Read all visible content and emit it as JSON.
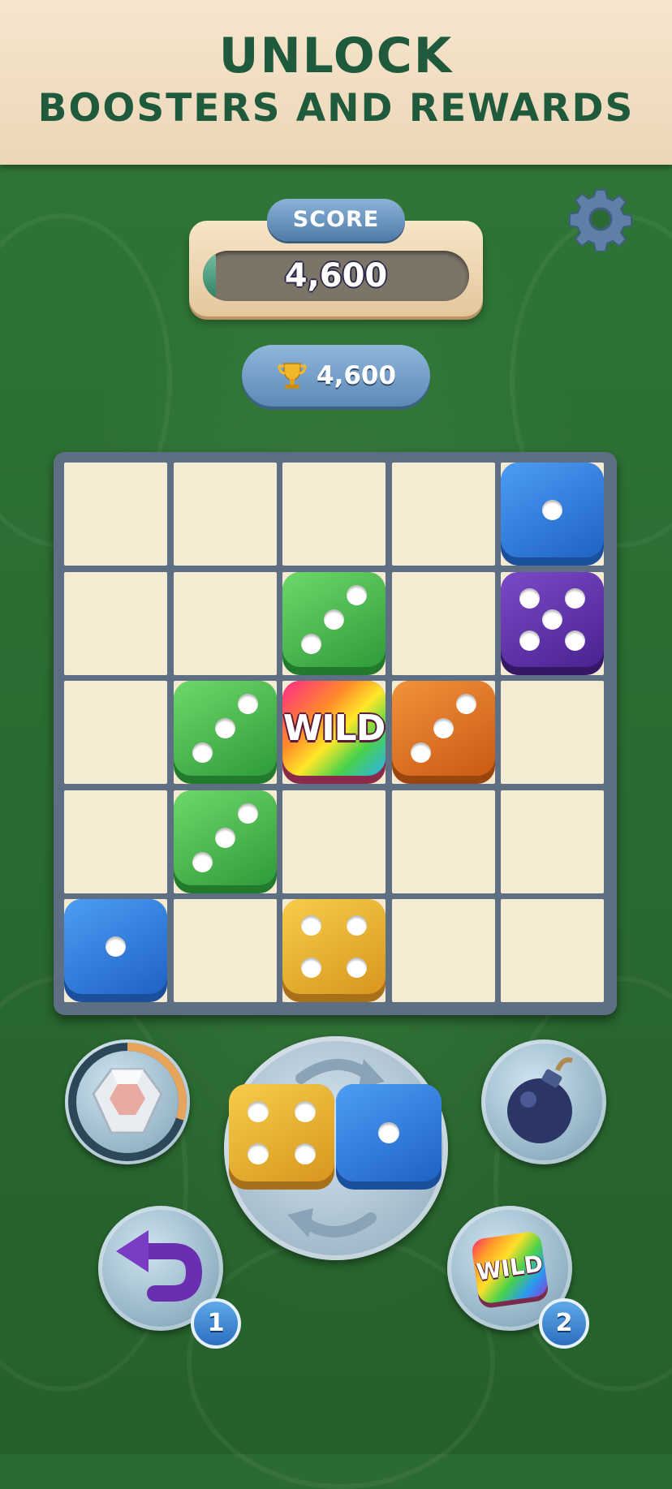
{
  "banner": {
    "line1": "UNLOCK",
    "line2": "BOOSTERS AND REWARDS"
  },
  "header": {
    "score_label": "SCORE",
    "score_value": "4,600",
    "score_progress": 0.05,
    "best_value": "4,600",
    "settings_icon": "gear-icon",
    "best_icon": "trophy-icon"
  },
  "board": {
    "rows": 5,
    "cols": 5,
    "dice": [
      {
        "row": 0,
        "col": 4,
        "value": 1,
        "color": "blue"
      },
      {
        "row": 1,
        "col": 2,
        "value": 3,
        "color": "green"
      },
      {
        "row": 1,
        "col": 4,
        "value": 5,
        "color": "purple"
      },
      {
        "row": 2,
        "col": 1,
        "value": 3,
        "color": "green"
      },
      {
        "row": 2,
        "col": 2,
        "value": "WILD",
        "color": "rainbow"
      },
      {
        "row": 2,
        "col": 3,
        "value": 3,
        "color": "orange"
      },
      {
        "row": 3,
        "col": 1,
        "value": 3,
        "color": "green"
      },
      {
        "row": 4,
        "col": 0,
        "value": 1,
        "color": "blue"
      },
      {
        "row": 4,
        "col": 2,
        "value": 4,
        "color": "yellow"
      }
    ]
  },
  "next_piece": [
    {
      "value": 4,
      "color": "yellow"
    },
    {
      "value": 1,
      "color": "blue"
    }
  ],
  "boosters": {
    "diamond": {
      "icon": "diamond-icon",
      "progress": 0.3
    },
    "bomb": {
      "icon": "bomb-icon"
    },
    "undo": {
      "icon": "undo-arrow-icon",
      "count": "1"
    },
    "wild": {
      "icon": "wild-die-icon",
      "label": "WILD",
      "count": "2"
    }
  },
  "colors": {
    "blue": "#2f7fe0",
    "green": "#3fb24a",
    "purple": "#5a2fa8",
    "orange": "#e0731f",
    "yellow": "#e3ac2a",
    "banner_text": "#1f5a3c"
  }
}
